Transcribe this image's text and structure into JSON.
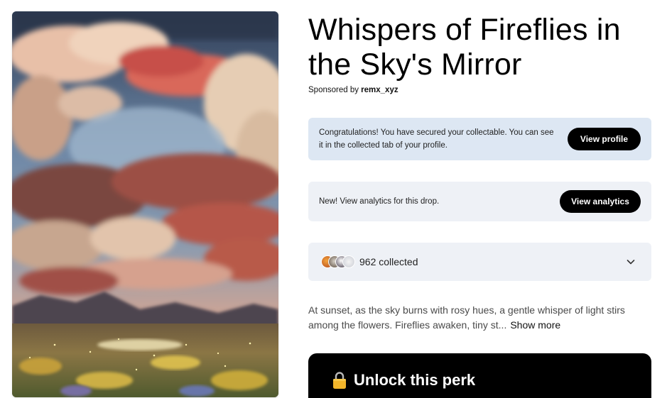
{
  "drop": {
    "title": "Whispers of Fireflies in the Sky's Mirror",
    "sponsor_prefix": "Sponsored by",
    "sponsor_name": "remx_xyz"
  },
  "congrats_card": {
    "text": "Congratulations! You have secured your collectable. You can see it in the collected tab of your profile.",
    "button_label": "View profile"
  },
  "analytics_card": {
    "text": "New! View analytics for this drop.",
    "button_label": "View analytics"
  },
  "collected": {
    "count_label": "962 collected",
    "avatar_count": 4
  },
  "description": {
    "text": "At sunset, as the sky burns with rosy hues, a gentle whisper of light stirs among the flowers. Fireflies awaken, tiny st...",
    "toggle_label": "Show more"
  },
  "perk": {
    "label": "Unlock this perk",
    "icon": "lock-icon"
  },
  "artwork": {
    "icon": "painting-of-clouds-over-flower-meadow"
  },
  "colors": {
    "congrats_bg": "#dde7f3",
    "card_bg": "#eef1f6",
    "button_bg": "#000000",
    "lock_gold": "#f2b52a"
  }
}
